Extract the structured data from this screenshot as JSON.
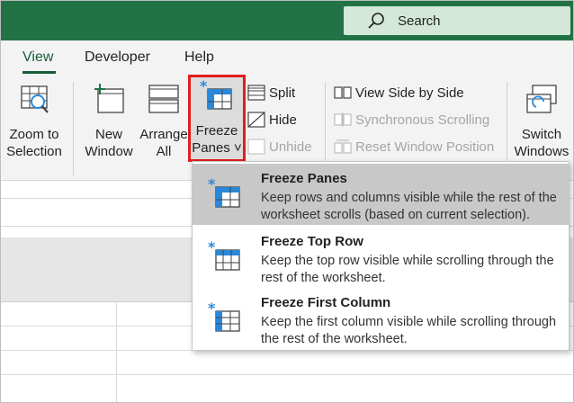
{
  "search": {
    "placeholder": "Search"
  },
  "tabs": [
    {
      "label": "View",
      "active": true
    },
    {
      "label": "Developer",
      "active": false
    },
    {
      "label": "Help",
      "active": false
    }
  ],
  "ribbon": {
    "zoom_to_selection": {
      "line1": "Zoom to",
      "line2": "Selection"
    },
    "new_window": {
      "line1": "New",
      "line2": "Window"
    },
    "arrange_all": {
      "line1": "Arrange",
      "line2": "All"
    },
    "freeze_panes": {
      "line1": "Freeze",
      "line2": "Panes ˅"
    },
    "split": "Split",
    "hide": "Hide",
    "unhide": "Unhide",
    "view_side_by_side": "View Side by Side",
    "synchronous_scrolling": "Synchronous Scrolling",
    "reset_window_position": "Reset Window Position",
    "switch_windows": {
      "line1": "Switch",
      "line2": "Windows"
    }
  },
  "menu": {
    "items": [
      {
        "title": "Freeze Panes",
        "description": "Keep rows and columns visible while the rest of the worksheet scrolls (based on current selection).",
        "selected": true
      },
      {
        "title": "Freeze Top Row",
        "description": "Keep the top row visible while scrolling through the rest of the worksheet.",
        "selected": false
      },
      {
        "title": "Freeze First Column",
        "description": "Keep the first column visible while scrolling through the rest of the worksheet.",
        "selected": false
      }
    ]
  },
  "colors": {
    "accent": "#217346",
    "highlight": "#e21d1d",
    "icon_blue": "#2b88d8"
  }
}
